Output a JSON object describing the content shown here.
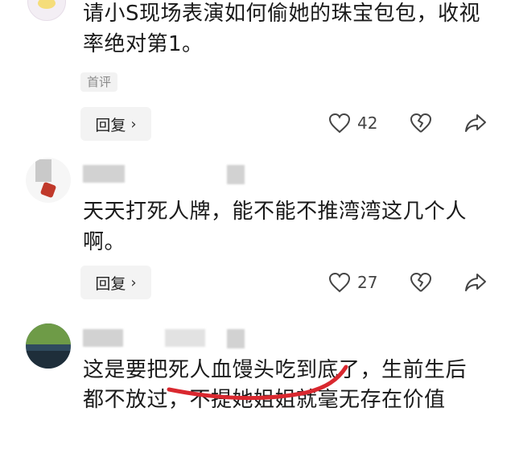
{
  "comments": [
    {
      "text": "请小S现场表演如何偷她的珠宝包包，收视率绝对第1。",
      "tag": "首评",
      "reply_label": "回复",
      "likes": "42"
    },
    {
      "text": "天天打死人牌，能不能不推湾湾这几个人啊。",
      "reply_label": "回复",
      "likes": "27"
    },
    {
      "text": "这是要把死人血馒头吃到底了，生前生后都不放过，不提她姐姐就毫无存在价值"
    }
  ],
  "icons": {
    "like": "heart-outline-icon",
    "dislike": "broken-heart-icon",
    "share": "share-arrow-icon",
    "reply_chevron": "chevron-right-icon"
  },
  "colors": {
    "annotation_stroke": "#d9282f",
    "reply_button_bg": "#f3f3f3"
  }
}
